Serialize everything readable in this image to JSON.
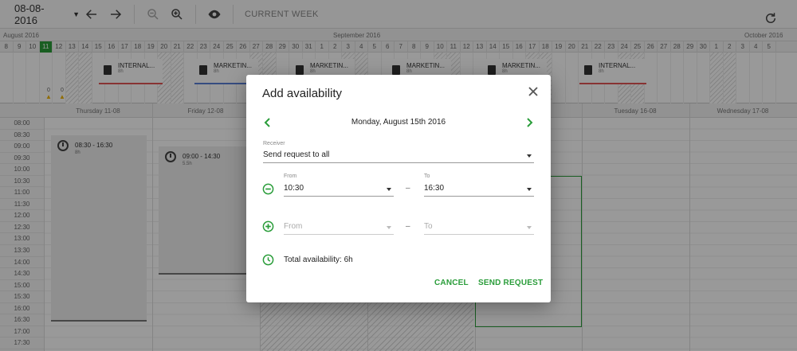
{
  "toolbar": {
    "date": "08-08-2016",
    "current_week": "CURRENT WEEK"
  },
  "timeline": {
    "months": [
      "August 2016",
      "September 2016",
      "October 2016"
    ],
    "days": [
      "8",
      "9",
      "10",
      "11",
      "12",
      "13",
      "14",
      "15",
      "16",
      "17",
      "18",
      "19",
      "20",
      "21",
      "22",
      "23",
      "24",
      "25",
      "26",
      "27",
      "28",
      "29",
      "30",
      "31",
      "1",
      "2",
      "3",
      "4",
      "5",
      "6",
      "7",
      "8",
      "9",
      "10",
      "11",
      "12",
      "13",
      "14",
      "15",
      "16",
      "17",
      "18",
      "19",
      "20",
      "21",
      "22",
      "23",
      "24",
      "25",
      "26",
      "27",
      "28",
      "29",
      "30",
      "1",
      "2",
      "3",
      "4",
      "5"
    ],
    "today_index": 3,
    "cards": [
      {
        "name": "INTERNAL...",
        "hours": "8h",
        "line": "red"
      },
      {
        "name": "MARKETIN...",
        "hours": "8h",
        "line": "blue"
      },
      {
        "name": "MARKETIN...",
        "hours": "8h",
        "line": "red"
      },
      {
        "name": "MARKETIN...",
        "hours": "8h",
        "line": "red"
      },
      {
        "name": "MARKETIN...",
        "hours": "8h",
        "line": "red"
      },
      {
        "name": "INTERNAL...",
        "hours": "8h",
        "line": "red"
      }
    ],
    "warnings": [
      "0",
      "0"
    ]
  },
  "week": {
    "days": [
      "Thursday 11-08",
      "Friday 12-08",
      "",
      "",
      "",
      "Tuesday 16-08",
      "Wednesday 17-08"
    ],
    "times": [
      "08:00",
      "08:30",
      "09:00",
      "09:30",
      "10:00",
      "10:30",
      "11:00",
      "11:30",
      "12:00",
      "12:30",
      "13:00",
      "13:30",
      "14:00",
      "14:30",
      "15:00",
      "15:30",
      "16:00",
      "16:30",
      "17:00",
      "17:30"
    ],
    "shifts": [
      {
        "time": "08:30 - 16:30",
        "hours": "8h"
      },
      {
        "time": "09:00 - 14:30",
        "hours": "5.5h"
      }
    ]
  },
  "modal": {
    "title": "Add availability",
    "date": "Monday, August 15th 2016",
    "receiver_label": "Receiver",
    "receiver_value": "Send request to all",
    "from_label": "From",
    "to_label": "To",
    "from_value": "10:30",
    "to_value": "16:30",
    "from_placeholder": "From",
    "to_placeholder": "To",
    "range_sep": "–",
    "total": "Total availability: 6h",
    "cancel": "CANCEL",
    "send": "SEND REQUEST"
  },
  "colors": {
    "accent": "#2a9d3a",
    "overlay": "rgba(0,0,0,0.40)"
  }
}
